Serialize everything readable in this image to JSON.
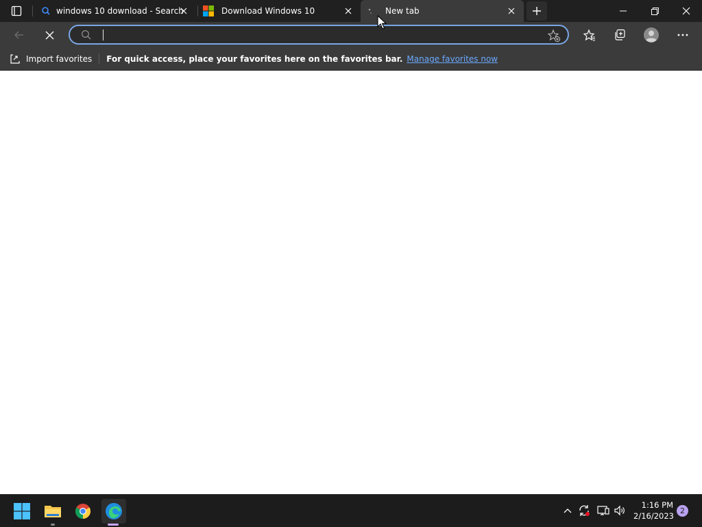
{
  "tabs": [
    {
      "title": "windows 10 download - Search",
      "icon": "search-icon"
    },
    {
      "title": "Download Windows 10",
      "icon": "microsoft-logo-icon"
    },
    {
      "title": "New tab",
      "icon": "loading-icon",
      "active": true
    }
  ],
  "address_bar": {
    "value": "",
    "placeholder": ""
  },
  "favorites_bar": {
    "import_label": "Import favorites",
    "message": "For quick access, place your favorites here on the favorites bar.",
    "link_label": "Manage favorites now"
  },
  "taskbar": {
    "apps": [
      "start-icon",
      "file-explorer-icon",
      "chrome-icon",
      "edge-icon"
    ],
    "time": "1:16 PM",
    "date": "2/16/2023",
    "notification_count": "2"
  },
  "colors": {
    "accent": "#7aa7e6",
    "link": "#6aa9ff",
    "chrome_dark": "#202020",
    "toolbar": "#3b3b3b"
  }
}
